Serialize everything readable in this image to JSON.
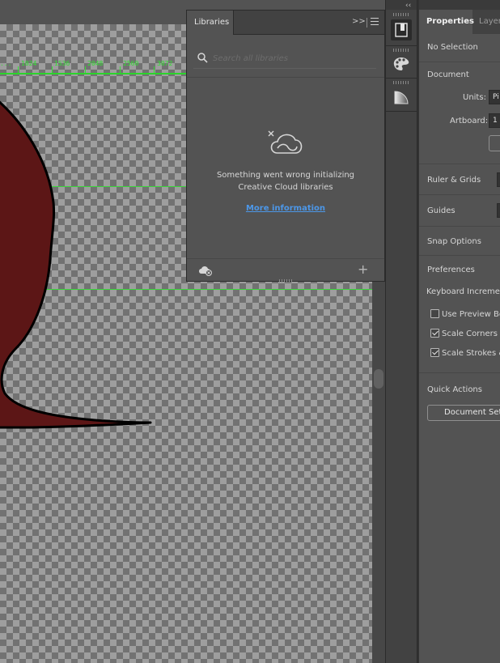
{
  "canvas": {
    "ruler_labels": [
      "...",
      "1024",
      "1536",
      "2048",
      "2560",
      "3072"
    ]
  },
  "libraries": {
    "tab_label": "Libraries",
    "expand_glyph": ">>",
    "search_placeholder": "Search all libraries",
    "error_line1": "Something went wrong initializing",
    "error_line2": "Creative Cloud libraries",
    "more_info_link": "More information",
    "add_glyph": "+"
  },
  "toolstrip": {
    "collapse_glyph": "‹‹"
  },
  "properties": {
    "tab_active": "Properties",
    "tab_layers": "Layers",
    "no_selection": "No Selection",
    "document_heading": "Document",
    "units_label": "Units:",
    "units_value": "Pi",
    "artboard_label": "Artboard:",
    "artboard_value": "1",
    "ruler_grids": "Ruler & Grids",
    "guides": "Guides",
    "snap_options": "Snap Options",
    "preferences": "Preferences",
    "keyboard_increment": "Keyboard Increment:",
    "use_preview_bounds": "Use Preview Bou",
    "scale_corners": "Scale Corners",
    "scale_strokes": "Scale Strokes &",
    "quick_actions": "Quick Actions",
    "document_setup": "Document Setu"
  },
  "colors": {
    "shape_fill": "#5c1616",
    "guide_green": "#3ad63a",
    "link_blue": "#4c97e8"
  }
}
